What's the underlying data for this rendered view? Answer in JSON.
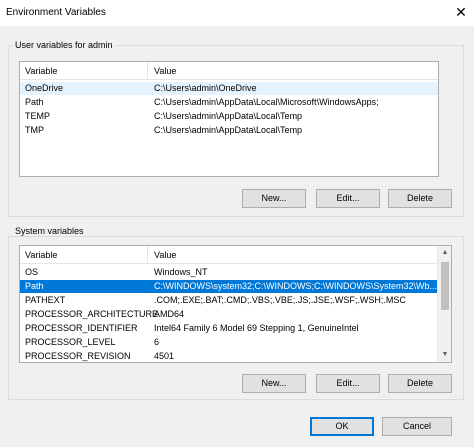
{
  "window": {
    "title": "Environment Variables",
    "close_glyph": "✕"
  },
  "user_group": {
    "label": "User variables for admin",
    "columns": {
      "variable": "Variable",
      "value": "Value"
    },
    "rows": [
      {
        "name": "OneDrive",
        "value": "C:\\Users\\admin\\OneDrive"
      },
      {
        "name": "Path",
        "value": "C:\\Users\\admin\\AppData\\Local\\Microsoft\\WindowsApps;"
      },
      {
        "name": "TEMP",
        "value": "C:\\Users\\admin\\AppData\\Local\\Temp"
      },
      {
        "name": "TMP",
        "value": "C:\\Users\\admin\\AppData\\Local\\Temp"
      }
    ],
    "buttons": {
      "new": "New...",
      "edit": "Edit...",
      "delete": "Delete"
    }
  },
  "system_group": {
    "label": "System variables",
    "columns": {
      "variable": "Variable",
      "value": "Value"
    },
    "rows": [
      {
        "name": "OS",
        "value": "Windows_NT"
      },
      {
        "name": "Path",
        "value": "C:\\WINDOWS\\system32;C:\\WINDOWS;C:\\WINDOWS\\System32\\Wb..."
      },
      {
        "name": "PATHEXT",
        "value": ".COM;.EXE;.BAT;.CMD;.VBS;.VBE;.JS;.JSE;.WSF;.WSH;.MSC"
      },
      {
        "name": "PROCESSOR_ARCHITECTURE",
        "value": "AMD64"
      },
      {
        "name": "PROCESSOR_IDENTIFIER",
        "value": "Intel64 Family 6 Model 69 Stepping 1, GenuineIntel"
      },
      {
        "name": "PROCESSOR_LEVEL",
        "value": "6"
      },
      {
        "name": "PROCESSOR_REVISION",
        "value": "4501"
      }
    ],
    "selected_row": "Path",
    "buttons": {
      "new": "New...",
      "edit": "Edit...",
      "delete": "Delete"
    }
  },
  "dialog_buttons": {
    "ok": "OK",
    "cancel": "Cancel"
  },
  "colors": {
    "selection": "#0078d7",
    "background": "#f0f0f0"
  },
  "scroll": {
    "up_glyph": "▲",
    "down_glyph": "▼"
  }
}
